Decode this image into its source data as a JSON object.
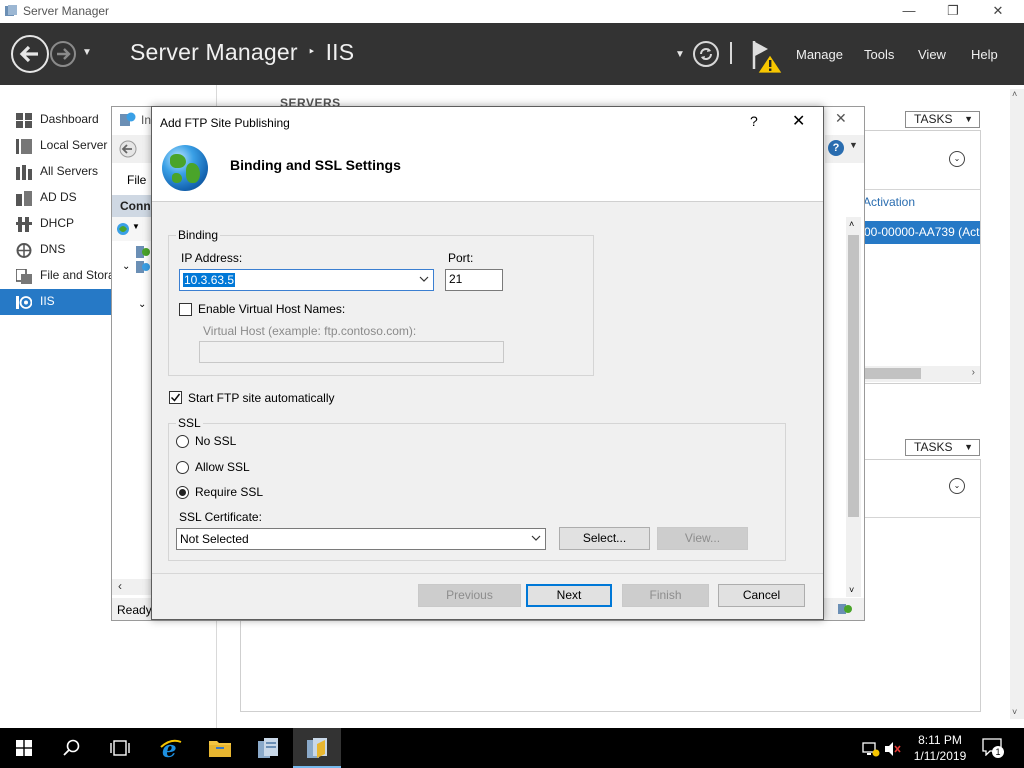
{
  "window": {
    "title": "Server Manager",
    "minimize": "—",
    "maximize": "❐",
    "close": "✕"
  },
  "header": {
    "app": "Server Manager",
    "separator": "‣",
    "section": "IIS",
    "menu": [
      "Manage",
      "Tools",
      "View",
      "Help"
    ]
  },
  "sidebar": {
    "items": [
      {
        "label": "Dashboard",
        "icon": "dashboard-icon"
      },
      {
        "label": "Local Server",
        "icon": "local-server-icon"
      },
      {
        "label": "All Servers",
        "icon": "all-servers-icon"
      },
      {
        "label": "AD DS",
        "icon": "ad-ds-icon"
      },
      {
        "label": "DHCP",
        "icon": "dhcp-icon"
      },
      {
        "label": "DNS",
        "icon": "dns-icon"
      },
      {
        "label": "File and Storage Services",
        "icon": "file-storage-icon"
      },
      {
        "label": "IIS",
        "icon": "iis-icon",
        "active": true
      }
    ]
  },
  "main": {
    "servers_title": "SERVERS",
    "tasks_label": "TASKS",
    "activation_header": "Activation",
    "activation_value": "00-00000-AA739 (Act"
  },
  "iis_window": {
    "title_fragment": "In",
    "menu_file": "File",
    "connections_fragment": "Conn",
    "status": "Ready"
  },
  "dialog": {
    "title": "Add FTP Site Publishing",
    "help": "?",
    "close": "✕",
    "heading": "Binding and SSL Settings",
    "binding": {
      "group_label": "Binding",
      "ip_label": "IP Address:",
      "ip_value": "10.3.63.5",
      "port_label": "Port:",
      "port_value": "21",
      "virtual_host_check_label": "Enable Virtual Host Names:",
      "virtual_host_label": "Virtual Host (example: ftp.contoso.com):",
      "virtual_host_value": ""
    },
    "start_auto_label": "Start FTP site automatically",
    "ssl": {
      "group_label": "SSL",
      "options": [
        "No SSL",
        "Allow SSL",
        "Require SSL"
      ],
      "selected": "Require SSL",
      "cert_label": "SSL Certificate:",
      "cert_value": "Not Selected",
      "select_button": "Select...",
      "view_button": "View..."
    },
    "buttons": {
      "previous": "Previous",
      "next": "Next",
      "finish": "Finish",
      "cancel": "Cancel"
    }
  },
  "taskbar": {
    "time": "8:11 PM",
    "date": "1/11/2019",
    "notification_count": "1"
  }
}
